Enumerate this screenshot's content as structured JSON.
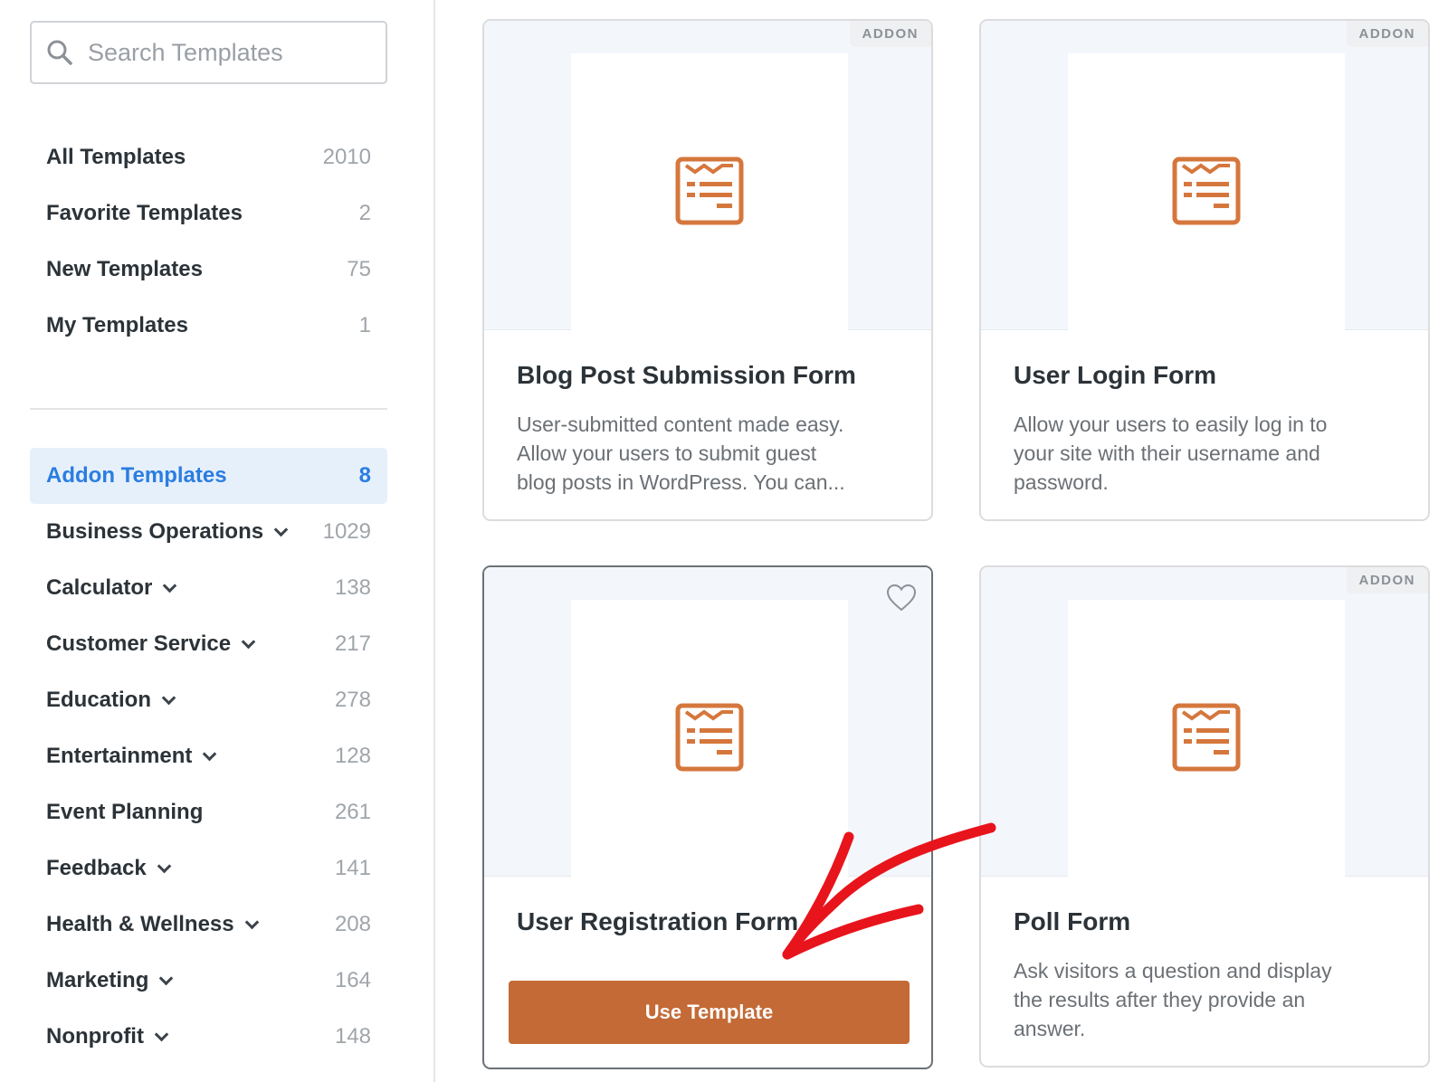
{
  "search": {
    "placeholder": "Search Templates"
  },
  "sidebar": {
    "primary": [
      {
        "label": "All Templates",
        "count": "2010"
      },
      {
        "label": "Favorite Templates",
        "count": "2"
      },
      {
        "label": "New Templates",
        "count": "75"
      },
      {
        "label": "My Templates",
        "count": "1"
      }
    ],
    "categories": [
      {
        "label": "Addon Templates",
        "count": "8",
        "active": true
      },
      {
        "label": "Business Operations",
        "count": "1029",
        "expandable": true
      },
      {
        "label": "Calculator",
        "count": "138",
        "expandable": true
      },
      {
        "label": "Customer Service",
        "count": "217",
        "expandable": true
      },
      {
        "label": "Education",
        "count": "278",
        "expandable": true
      },
      {
        "label": "Entertainment",
        "count": "128",
        "expandable": true
      },
      {
        "label": "Event Planning",
        "count": "261",
        "expandable": false
      },
      {
        "label": "Feedback",
        "count": "141",
        "expandable": true
      },
      {
        "label": "Health & Wellness",
        "count": "208",
        "expandable": true
      },
      {
        "label": "Marketing",
        "count": "164",
        "expandable": true
      },
      {
        "label": "Nonprofit",
        "count": "148",
        "expandable": true
      }
    ]
  },
  "cards": [
    {
      "title": "Blog Post Submission Form",
      "badge": "ADDON",
      "desc_lines": [
        "User-submitted content made easy.",
        "Allow your users to submit guest",
        "blog posts in WordPress. You can..."
      ]
    },
    {
      "title": "User Login Form",
      "badge": "ADDON",
      "desc_lines": [
        "Allow your users to easily log in to",
        "your site with their username and",
        "password."
      ]
    },
    {
      "title": "User Registration Form",
      "button": "Use Template"
    },
    {
      "title": "Poll Form",
      "badge": "ADDON",
      "desc_lines": [
        "Ask visitors a question and display",
        "the results after they provide an",
        "answer."
      ]
    }
  ],
  "colors": {
    "accent": "#c46a36",
    "active_link": "#2a7de1",
    "active_bg": "#e6f0fb",
    "annotation_arrow": "#e8141c"
  }
}
